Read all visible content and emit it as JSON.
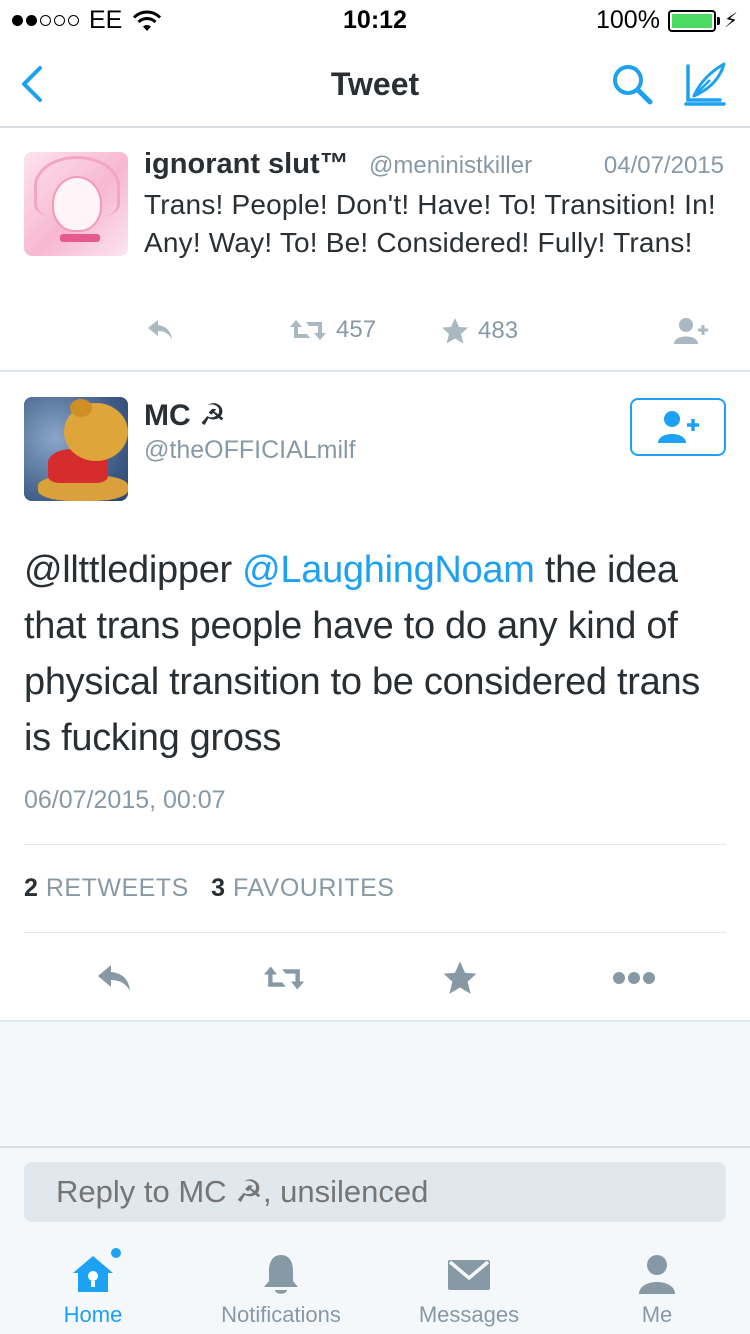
{
  "status_bar": {
    "carrier": "EE",
    "time": "10:12",
    "battery": "100%"
  },
  "nav": {
    "title": "Tweet"
  },
  "parent_tweet": {
    "name": "ignorant slut™",
    "handle": "@meninistkiller",
    "date": "04/07/2015",
    "text": "Trans! People! Don't! Have! To! Transition! In! Any! Way! To! Be! Considered! Fully! Trans!",
    "retweets": "457",
    "favourites": "483"
  },
  "main_tweet": {
    "name": "MC ☭",
    "handle": "@theOFFICIALmilf",
    "mention_1": "@llttledipper",
    "mention_2": "@LaughingNoam",
    "text_rest": " the idea that trans people have to do any kind of physical transition to be considered trans is fucking gross",
    "timestamp": "06/07/2015, 00:07",
    "retweet_count": "2",
    "retweet_label": "RETWEETS",
    "favourite_count": "3",
    "favourite_label": "FAVOURITES"
  },
  "reply": {
    "placeholder": "Reply to MC ☭, unsilenced"
  },
  "tabs": [
    {
      "label": "Home",
      "icon": "home-icon",
      "active": true
    },
    {
      "label": "Notifications",
      "icon": "bell-icon",
      "active": false
    },
    {
      "label": "Messages",
      "icon": "envelope-icon",
      "active": false
    },
    {
      "label": "Me",
      "icon": "person-icon",
      "active": false
    }
  ],
  "colors": {
    "accent": "#1da1f2",
    "text": "#292f33",
    "muted": "#8899a6",
    "icon_gray": "#aab8c2"
  }
}
